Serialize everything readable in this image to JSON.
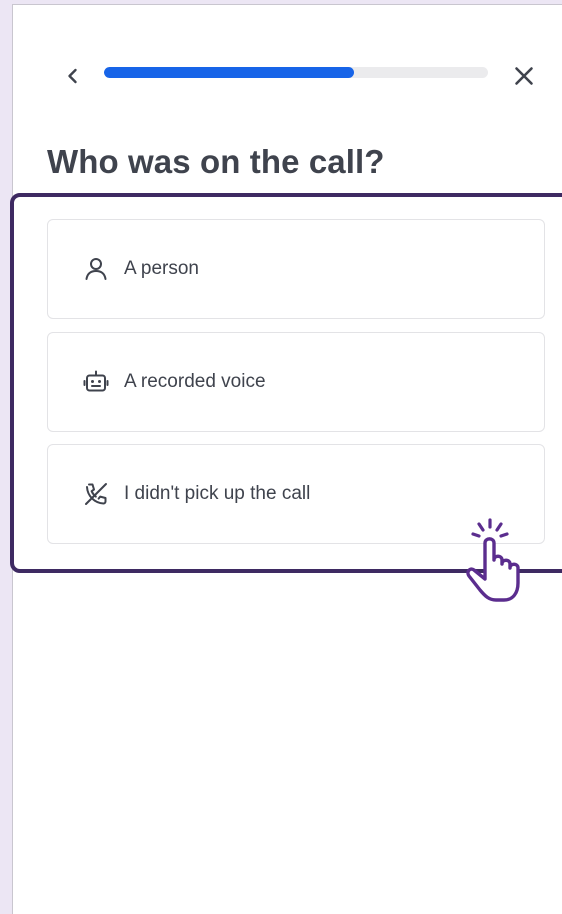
{
  "header": {
    "back_icon": "chevron-left-icon",
    "close_icon": "close-icon",
    "progress_fraction": 0.65,
    "progress_color": "#1764e8",
    "progress_track_color": "#ebebed"
  },
  "question": {
    "title": "Who was on the call?"
  },
  "options": [
    {
      "label": "A person",
      "icon": "person-icon"
    },
    {
      "label": "A recorded voice",
      "icon": "robot-icon"
    },
    {
      "label": "I didn't pick up the call",
      "icon": "phone-missed-icon"
    }
  ],
  "annotation": {
    "frame_color": "#3e2a62",
    "cursor_icon": "pointing-hand-click-icon",
    "cursor_color": "#5b2d8e"
  }
}
